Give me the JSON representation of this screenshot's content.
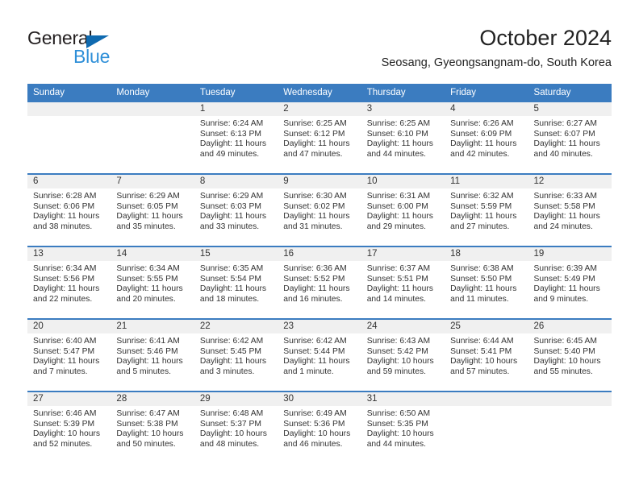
{
  "logo": {
    "word_top": "General",
    "word_bottom": "Blue",
    "triangle_color": "#0f6ab0",
    "blue_color": "#2e8fd8",
    "top_color": "#231f20"
  },
  "header": {
    "title": "October 2024",
    "subtitle": "Seosang, Gyeongsangnam-do, South Korea"
  },
  "theme": {
    "header_blue": "#3b7cc0",
    "daynum_band": "#f0f0f0",
    "text": "#333333"
  },
  "weekdays": [
    "Sunday",
    "Monday",
    "Tuesday",
    "Wednesday",
    "Thursday",
    "Friday",
    "Saturday"
  ],
  "weeks": [
    [
      {
        "day": "",
        "lines": []
      },
      {
        "day": "",
        "lines": []
      },
      {
        "day": "1",
        "lines": [
          "Sunrise: 6:24 AM",
          "Sunset: 6:13 PM",
          "Daylight: 11 hours",
          "and 49 minutes."
        ]
      },
      {
        "day": "2",
        "lines": [
          "Sunrise: 6:25 AM",
          "Sunset: 6:12 PM",
          "Daylight: 11 hours",
          "and 47 minutes."
        ]
      },
      {
        "day": "3",
        "lines": [
          "Sunrise: 6:25 AM",
          "Sunset: 6:10 PM",
          "Daylight: 11 hours",
          "and 44 minutes."
        ]
      },
      {
        "day": "4",
        "lines": [
          "Sunrise: 6:26 AM",
          "Sunset: 6:09 PM",
          "Daylight: 11 hours",
          "and 42 minutes."
        ]
      },
      {
        "day": "5",
        "lines": [
          "Sunrise: 6:27 AM",
          "Sunset: 6:07 PM",
          "Daylight: 11 hours",
          "and 40 minutes."
        ]
      }
    ],
    [
      {
        "day": "6",
        "lines": [
          "Sunrise: 6:28 AM",
          "Sunset: 6:06 PM",
          "Daylight: 11 hours",
          "and 38 minutes."
        ]
      },
      {
        "day": "7",
        "lines": [
          "Sunrise: 6:29 AM",
          "Sunset: 6:05 PM",
          "Daylight: 11 hours",
          "and 35 minutes."
        ]
      },
      {
        "day": "8",
        "lines": [
          "Sunrise: 6:29 AM",
          "Sunset: 6:03 PM",
          "Daylight: 11 hours",
          "and 33 minutes."
        ]
      },
      {
        "day": "9",
        "lines": [
          "Sunrise: 6:30 AM",
          "Sunset: 6:02 PM",
          "Daylight: 11 hours",
          "and 31 minutes."
        ]
      },
      {
        "day": "10",
        "lines": [
          "Sunrise: 6:31 AM",
          "Sunset: 6:00 PM",
          "Daylight: 11 hours",
          "and 29 minutes."
        ]
      },
      {
        "day": "11",
        "lines": [
          "Sunrise: 6:32 AM",
          "Sunset: 5:59 PM",
          "Daylight: 11 hours",
          "and 27 minutes."
        ]
      },
      {
        "day": "12",
        "lines": [
          "Sunrise: 6:33 AM",
          "Sunset: 5:58 PM",
          "Daylight: 11 hours",
          "and 24 minutes."
        ]
      }
    ],
    [
      {
        "day": "13",
        "lines": [
          "Sunrise: 6:34 AM",
          "Sunset: 5:56 PM",
          "Daylight: 11 hours",
          "and 22 minutes."
        ]
      },
      {
        "day": "14",
        "lines": [
          "Sunrise: 6:34 AM",
          "Sunset: 5:55 PM",
          "Daylight: 11 hours",
          "and 20 minutes."
        ]
      },
      {
        "day": "15",
        "lines": [
          "Sunrise: 6:35 AM",
          "Sunset: 5:54 PM",
          "Daylight: 11 hours",
          "and 18 minutes."
        ]
      },
      {
        "day": "16",
        "lines": [
          "Sunrise: 6:36 AM",
          "Sunset: 5:52 PM",
          "Daylight: 11 hours",
          "and 16 minutes."
        ]
      },
      {
        "day": "17",
        "lines": [
          "Sunrise: 6:37 AM",
          "Sunset: 5:51 PM",
          "Daylight: 11 hours",
          "and 14 minutes."
        ]
      },
      {
        "day": "18",
        "lines": [
          "Sunrise: 6:38 AM",
          "Sunset: 5:50 PM",
          "Daylight: 11 hours",
          "and 11 minutes."
        ]
      },
      {
        "day": "19",
        "lines": [
          "Sunrise: 6:39 AM",
          "Sunset: 5:49 PM",
          "Daylight: 11 hours",
          "and 9 minutes."
        ]
      }
    ],
    [
      {
        "day": "20",
        "lines": [
          "Sunrise: 6:40 AM",
          "Sunset: 5:47 PM",
          "Daylight: 11 hours",
          "and 7 minutes."
        ]
      },
      {
        "day": "21",
        "lines": [
          "Sunrise: 6:41 AM",
          "Sunset: 5:46 PM",
          "Daylight: 11 hours",
          "and 5 minutes."
        ]
      },
      {
        "day": "22",
        "lines": [
          "Sunrise: 6:42 AM",
          "Sunset: 5:45 PM",
          "Daylight: 11 hours",
          "and 3 minutes."
        ]
      },
      {
        "day": "23",
        "lines": [
          "Sunrise: 6:42 AM",
          "Sunset: 5:44 PM",
          "Daylight: 11 hours",
          "and 1 minute."
        ]
      },
      {
        "day": "24",
        "lines": [
          "Sunrise: 6:43 AM",
          "Sunset: 5:42 PM",
          "Daylight: 10 hours",
          "and 59 minutes."
        ]
      },
      {
        "day": "25",
        "lines": [
          "Sunrise: 6:44 AM",
          "Sunset: 5:41 PM",
          "Daylight: 10 hours",
          "and 57 minutes."
        ]
      },
      {
        "day": "26",
        "lines": [
          "Sunrise: 6:45 AM",
          "Sunset: 5:40 PM",
          "Daylight: 10 hours",
          "and 55 minutes."
        ]
      }
    ],
    [
      {
        "day": "27",
        "lines": [
          "Sunrise: 6:46 AM",
          "Sunset: 5:39 PM",
          "Daylight: 10 hours",
          "and 52 minutes."
        ]
      },
      {
        "day": "28",
        "lines": [
          "Sunrise: 6:47 AM",
          "Sunset: 5:38 PM",
          "Daylight: 10 hours",
          "and 50 minutes."
        ]
      },
      {
        "day": "29",
        "lines": [
          "Sunrise: 6:48 AM",
          "Sunset: 5:37 PM",
          "Daylight: 10 hours",
          "and 48 minutes."
        ]
      },
      {
        "day": "30",
        "lines": [
          "Sunrise: 6:49 AM",
          "Sunset: 5:36 PM",
          "Daylight: 10 hours",
          "and 46 minutes."
        ]
      },
      {
        "day": "31",
        "lines": [
          "Sunrise: 6:50 AM",
          "Sunset: 5:35 PM",
          "Daylight: 10 hours",
          "and 44 minutes."
        ]
      },
      {
        "day": "",
        "lines": []
      },
      {
        "day": "",
        "lines": []
      }
    ]
  ]
}
